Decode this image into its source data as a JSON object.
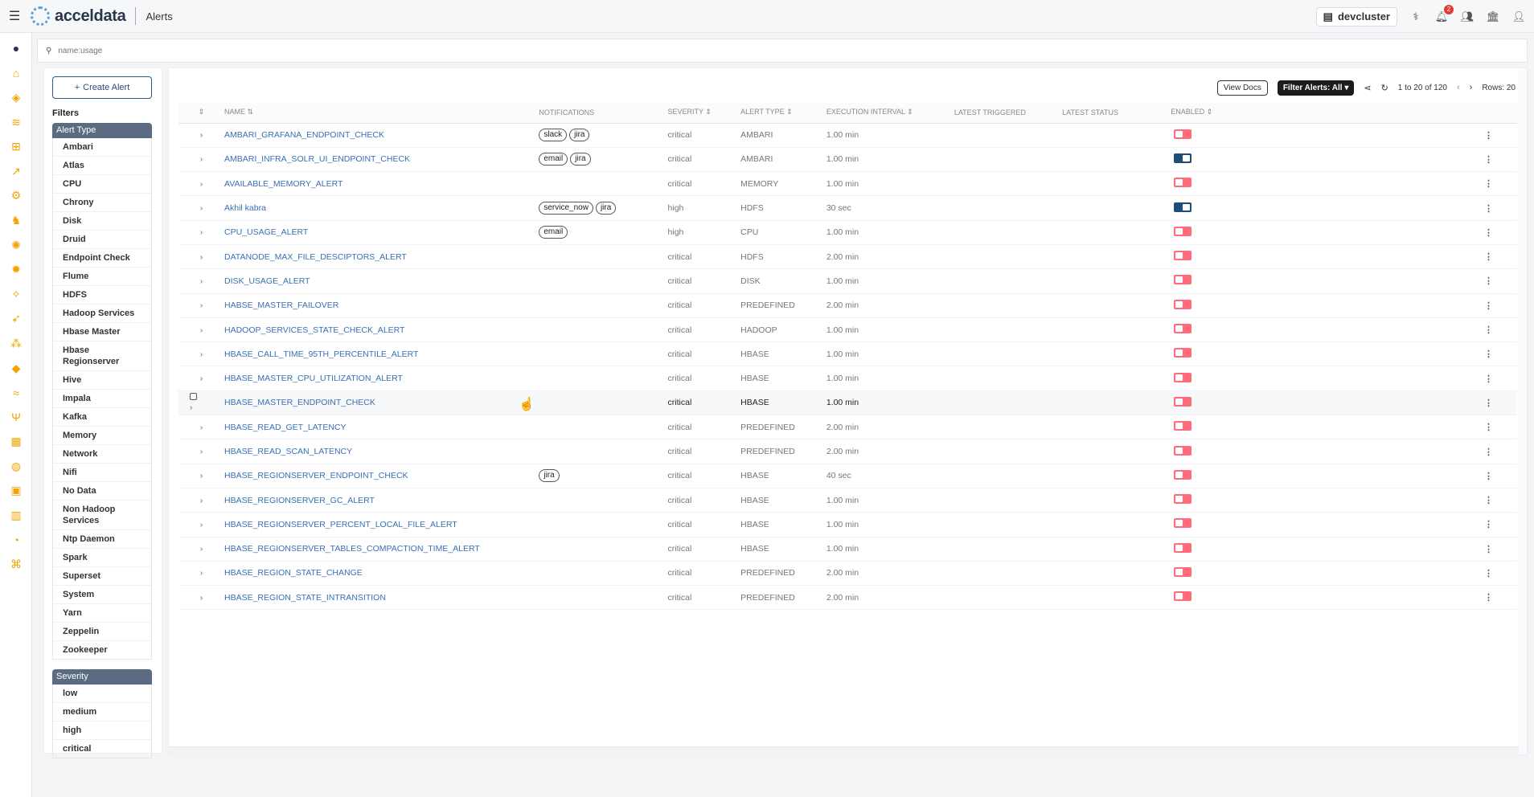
{
  "topbar": {
    "app_name": "acceldata",
    "page_title": "Alerts",
    "cluster_name": "devcluster",
    "notification_count": "2",
    "icons": [
      "health-icon",
      "bell-icon",
      "users-icon",
      "building-icon",
      "user-icon"
    ]
  },
  "sidebar": {
    "icons": [
      "menu-circle-icon",
      "home-icon",
      "cube-icon",
      "layers-icon",
      "hierarchy-icon",
      "chart-line-icon",
      "gear-cube-icon",
      "elephant-icon",
      "bee-icon",
      "hive-icon",
      "network-icon",
      "bird-icon",
      "cluster-icon",
      "drop-icon",
      "wind-icon",
      "fork-icon",
      "document-icon",
      "database-icon",
      "grid-icon",
      "printer-icon",
      "bell-icon",
      "command-icon"
    ]
  },
  "search": {
    "placeholder": "name:usage"
  },
  "filters": {
    "create_label": "Create Alert",
    "title": "Filters",
    "alert_type_heading": "Alert Type",
    "alert_types": [
      "Ambari",
      "Atlas",
      "CPU",
      "Chrony",
      "Disk",
      "Druid",
      "Endpoint Check",
      "Flume",
      "HDFS",
      "Hadoop Services",
      "Hbase Master",
      "Hbase Regionserver",
      "Hive",
      "Impala",
      "Kafka",
      "Memory",
      "Network",
      "Nifi",
      "No Data",
      "Non Hadoop Services",
      "Ntp Daemon",
      "Spark",
      "Superset",
      "System",
      "Yarn",
      "Zeppelin",
      "Zookeeper"
    ],
    "severity_heading": "Severity",
    "severities": [
      "low",
      "medium",
      "high",
      "critical"
    ]
  },
  "toolbar": {
    "view_docs": "View Docs",
    "filter_alerts": "Filter Alerts: All",
    "pagination": "1 to 20 of 120",
    "rows": "Rows: 20"
  },
  "table": {
    "columns": [
      "",
      "NAME",
      "NOTIFICATIONS",
      "SEVERITY",
      "ALERT TYPE",
      "EXECUTION INTERVAL",
      "LATEST TRIGGERED",
      "LATEST STATUS",
      "ENABLED",
      ""
    ],
    "rows": [
      {
        "name": "AMBARI_GRAFANA_ENDPOINT_CHECK",
        "notifications": [
          "slack",
          "jira"
        ],
        "severity": "critical",
        "type": "AMBARI",
        "interval": "1.00 min",
        "enabled": false
      },
      {
        "name": "AMBARI_INFRA_SOLR_UI_ENDPOINT_CHECK",
        "notifications": [
          "email",
          "jira"
        ],
        "severity": "critical",
        "type": "AMBARI",
        "interval": "1.00 min",
        "enabled": true
      },
      {
        "name": "AVAILABLE_MEMORY_ALERT",
        "notifications": [],
        "severity": "critical",
        "type": "MEMORY",
        "interval": "1.00 min",
        "enabled": false
      },
      {
        "name": "Akhil kabra",
        "notifications": [
          "service_now",
          "jira"
        ],
        "severity": "high",
        "type": "HDFS",
        "interval": "30 sec",
        "enabled": true
      },
      {
        "name": "CPU_USAGE_ALERT",
        "notifications": [
          "email"
        ],
        "severity": "high",
        "type": "CPU",
        "interval": "1.00 min",
        "enabled": false
      },
      {
        "name": "DATANODE_MAX_FILE_DESCIPTORS_ALERT",
        "notifications": [],
        "severity": "critical",
        "type": "HDFS",
        "interval": "2.00 min",
        "enabled": false
      },
      {
        "name": "DISK_USAGE_ALERT",
        "notifications": [],
        "severity": "critical",
        "type": "DISK",
        "interval": "1.00 min",
        "enabled": false
      },
      {
        "name": "HABSE_MASTER_FAILOVER",
        "notifications": [],
        "severity": "critical",
        "type": "PREDEFINED",
        "interval": "2.00 min",
        "enabled": false
      },
      {
        "name": "HADOOP_SERVICES_STATE_CHECK_ALERT",
        "notifications": [],
        "severity": "critical",
        "type": "HADOOP",
        "interval": "1.00 min",
        "enabled": false
      },
      {
        "name": "HBASE_CALL_TIME_95TH_PERCENTILE_ALERT",
        "notifications": [],
        "severity": "critical",
        "type": "HBASE",
        "interval": "1.00 min",
        "enabled": false
      },
      {
        "name": "HBASE_MASTER_CPU_UTILIZATION_ALERT",
        "notifications": [],
        "severity": "critical",
        "type": "HBASE",
        "interval": "1.00 min",
        "enabled": false
      },
      {
        "name": "HBASE_MASTER_ENDPOINT_CHECK",
        "notifications": [],
        "severity": "critical",
        "type": "HBASE",
        "interval": "1.00 min",
        "enabled": false,
        "hover": true
      },
      {
        "name": "HBASE_READ_GET_LATENCY",
        "notifications": [],
        "severity": "critical",
        "type": "PREDEFINED",
        "interval": "2.00 min",
        "enabled": false
      },
      {
        "name": "HBASE_READ_SCAN_LATENCY",
        "notifications": [],
        "severity": "critical",
        "type": "PREDEFINED",
        "interval": "2.00 min",
        "enabled": false
      },
      {
        "name": "HBASE_REGIONSERVER_ENDPOINT_CHECK",
        "notifications": [
          "jira"
        ],
        "severity": "critical",
        "type": "HBASE",
        "interval": "40 sec",
        "enabled": false
      },
      {
        "name": "HBASE_REGIONSERVER_GC_ALERT",
        "notifications": [],
        "severity": "critical",
        "type": "HBASE",
        "interval": "1.00 min",
        "enabled": false
      },
      {
        "name": "HBASE_REGIONSERVER_PERCENT_LOCAL_FILE_ALERT",
        "notifications": [],
        "severity": "critical",
        "type": "HBASE",
        "interval": "1.00 min",
        "enabled": false
      },
      {
        "name": "HBASE_REGIONSERVER_TABLES_COMPACTION_TIME_ALERT",
        "notifications": [],
        "severity": "critical",
        "type": "HBASE",
        "interval": "1.00 min",
        "enabled": false
      },
      {
        "name": "HBASE_REGION_STATE_CHANGE",
        "notifications": [],
        "severity": "critical",
        "type": "PREDEFINED",
        "interval": "2.00 min",
        "enabled": false
      },
      {
        "name": "HBASE_REGION_STATE_INTRANSITION",
        "notifications": [],
        "severity": "critical",
        "type": "PREDEFINED",
        "interval": "2.00 min",
        "enabled": false
      }
    ]
  },
  "colors": {
    "accent": "#3a6fb5",
    "toggle_on": "#1d4e7a",
    "toggle_off": "#ff6b7a",
    "filter_header": "#5a6b82"
  }
}
